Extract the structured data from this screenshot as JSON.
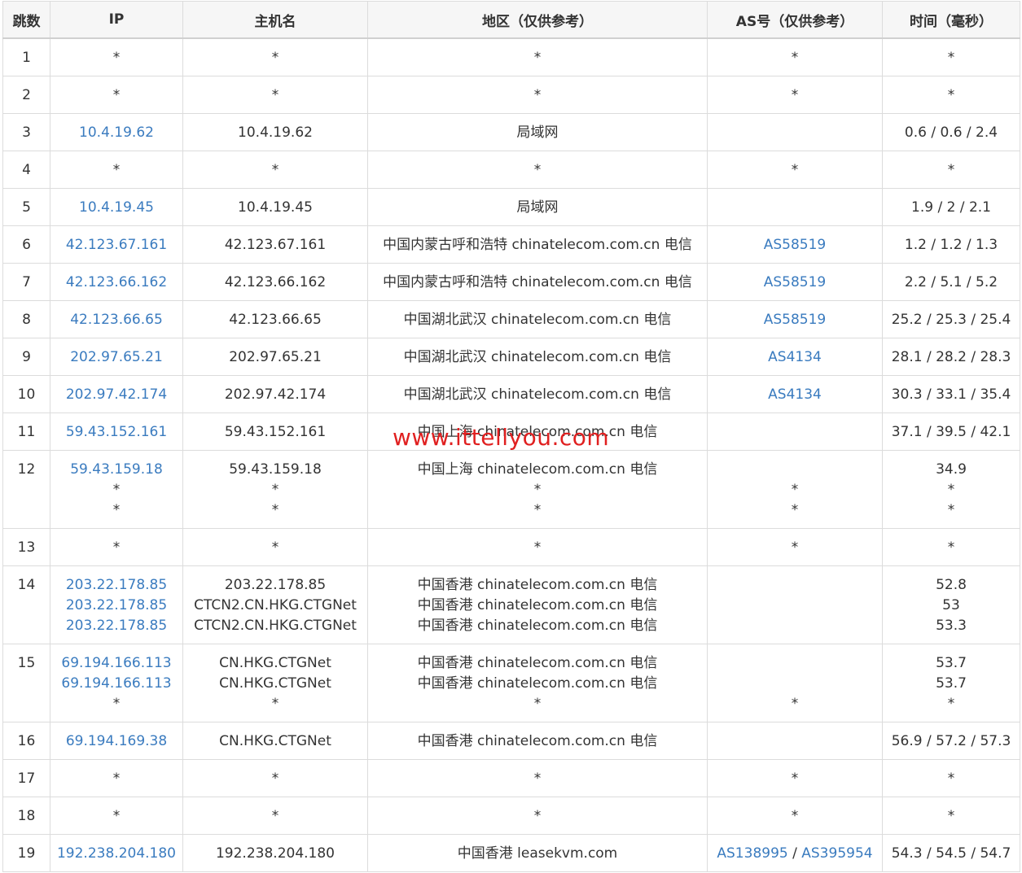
{
  "headers": [
    "跳数",
    "IP",
    "主机名",
    "地区（仅供参考）",
    "AS号（仅供参考）",
    "时间（毫秒）"
  ],
  "rows": [
    {
      "hop": "1",
      "ip": [
        "*"
      ],
      "host": [
        "*"
      ],
      "region": [
        "*"
      ],
      "as": [
        [
          "*"
        ]
      ],
      "time": [
        "*"
      ]
    },
    {
      "hop": "2",
      "ip": [
        "*"
      ],
      "host": [
        "*"
      ],
      "region": [
        "*"
      ],
      "as": [
        [
          "*"
        ]
      ],
      "time": [
        "*"
      ]
    },
    {
      "hop": "3",
      "ip": [
        "10.4.19.62"
      ],
      "host": [
        "10.4.19.62"
      ],
      "region": [
        "局域网"
      ],
      "as": [
        []
      ],
      "time": [
        "0.6 / 0.6 / 2.4"
      ]
    },
    {
      "hop": "4",
      "ip": [
        "*"
      ],
      "host": [
        "*"
      ],
      "region": [
        "*"
      ],
      "as": [
        [
          "*"
        ]
      ],
      "time": [
        "*"
      ]
    },
    {
      "hop": "5",
      "ip": [
        "10.4.19.45"
      ],
      "host": [
        "10.4.19.45"
      ],
      "region": [
        "局域网"
      ],
      "as": [
        []
      ],
      "time": [
        "1.9 / 2 / 2.1"
      ]
    },
    {
      "hop": "6",
      "ip": [
        "42.123.67.161"
      ],
      "host": [
        "42.123.67.161"
      ],
      "region": [
        "中国内蒙古呼和浩特 chinatelecom.com.cn 电信"
      ],
      "as": [
        [
          "AS58519"
        ]
      ],
      "time": [
        "1.2 / 1.2 / 1.3"
      ]
    },
    {
      "hop": "7",
      "ip": [
        "42.123.66.162"
      ],
      "host": [
        "42.123.66.162"
      ],
      "region": [
        "中国内蒙古呼和浩特 chinatelecom.com.cn 电信"
      ],
      "as": [
        [
          "AS58519"
        ]
      ],
      "time": [
        "2.2 / 5.1 / 5.2"
      ]
    },
    {
      "hop": "8",
      "ip": [
        "42.123.66.65"
      ],
      "host": [
        "42.123.66.65"
      ],
      "region": [
        "中国湖北武汉 chinatelecom.com.cn 电信"
      ],
      "as": [
        [
          "AS58519"
        ]
      ],
      "time": [
        "25.2 / 25.3 / 25.4"
      ]
    },
    {
      "hop": "9",
      "ip": [
        "202.97.65.21"
      ],
      "host": [
        "202.97.65.21"
      ],
      "region": [
        "中国湖北武汉 chinatelecom.com.cn 电信"
      ],
      "as": [
        [
          "AS4134"
        ]
      ],
      "time": [
        "28.1 / 28.2 / 28.3"
      ]
    },
    {
      "hop": "10",
      "ip": [
        "202.97.42.174"
      ],
      "host": [
        "202.97.42.174"
      ],
      "region": [
        "中国湖北武汉 chinatelecom.com.cn 电信"
      ],
      "as": [
        [
          "AS4134"
        ]
      ],
      "time": [
        "30.3 / 33.1 / 35.4"
      ]
    },
    {
      "hop": "11",
      "ip": [
        "59.43.152.161"
      ],
      "host": [
        "59.43.152.161"
      ],
      "region": [
        "中国上海 chinatelecom.com.cn 电信"
      ],
      "as": [
        []
      ],
      "time": [
        "37.1 / 39.5 / 42.1"
      ]
    },
    {
      "hop": "12",
      "ip": [
        "59.43.159.18",
        "*",
        "*"
      ],
      "host": [
        "59.43.159.18",
        "*",
        "*"
      ],
      "region": [
        "中国上海 chinatelecom.com.cn 电信",
        "*",
        "*"
      ],
      "as": [
        [],
        [
          "*"
        ],
        [
          "*"
        ]
      ],
      "time": [
        "34.9",
        "*",
        "*"
      ]
    },
    {
      "hop": "13",
      "ip": [
        "*"
      ],
      "host": [
        "*"
      ],
      "region": [
        "*"
      ],
      "as": [
        [
          "*"
        ]
      ],
      "time": [
        "*"
      ]
    },
    {
      "hop": "14",
      "ip": [
        "203.22.178.85",
        "203.22.178.85",
        "203.22.178.85"
      ],
      "host": [
        "203.22.178.85",
        "CTCN2.CN.HKG.CTGNet",
        "CTCN2.CN.HKG.CTGNet"
      ],
      "region": [
        "中国香港 chinatelecom.com.cn 电信",
        "中国香港 chinatelecom.com.cn 电信",
        "中国香港 chinatelecom.com.cn 电信"
      ],
      "as": [
        [],
        [],
        []
      ],
      "time": [
        "52.8",
        "53",
        "53.3"
      ]
    },
    {
      "hop": "15",
      "ip": [
        "69.194.166.113",
        "69.194.166.113",
        "*"
      ],
      "host": [
        "CN.HKG.CTGNet",
        "CN.HKG.CTGNet",
        "*"
      ],
      "region": [
        "中国香港 chinatelecom.com.cn 电信",
        "中国香港 chinatelecom.com.cn 电信",
        "*"
      ],
      "as": [
        [],
        [],
        [
          "*"
        ]
      ],
      "time": [
        "53.7",
        "53.7",
        "*"
      ]
    },
    {
      "hop": "16",
      "ip": [
        "69.194.169.38"
      ],
      "host": [
        "CN.HKG.CTGNet"
      ],
      "region": [
        "中国香港 chinatelecom.com.cn 电信"
      ],
      "as": [
        []
      ],
      "time": [
        "56.9 / 57.2 / 57.3"
      ]
    },
    {
      "hop": "17",
      "ip": [
        "*"
      ],
      "host": [
        "*"
      ],
      "region": [
        "*"
      ],
      "as": [
        [
          "*"
        ]
      ],
      "time": [
        "*"
      ]
    },
    {
      "hop": "18",
      "ip": [
        "*"
      ],
      "host": [
        "*"
      ],
      "region": [
        "*"
      ],
      "as": [
        [
          "*"
        ]
      ],
      "time": [
        "*"
      ]
    },
    {
      "hop": "19",
      "ip": [
        "192.238.204.180"
      ],
      "host": [
        "192.238.204.180"
      ],
      "region": [
        "中国香港 leasekvm.com"
      ],
      "as": [
        [
          "AS138995",
          "AS395954"
        ]
      ],
      "time": [
        "54.3 / 54.5 / 54.7"
      ]
    }
  ],
  "as_separator": " / ",
  "watermark": "www.ittellyou.com",
  "colors": {
    "link": "#3a7bbf",
    "watermark": "#e02020",
    "header_bg": "#f6f6f6",
    "border": "#dcdcdc"
  }
}
